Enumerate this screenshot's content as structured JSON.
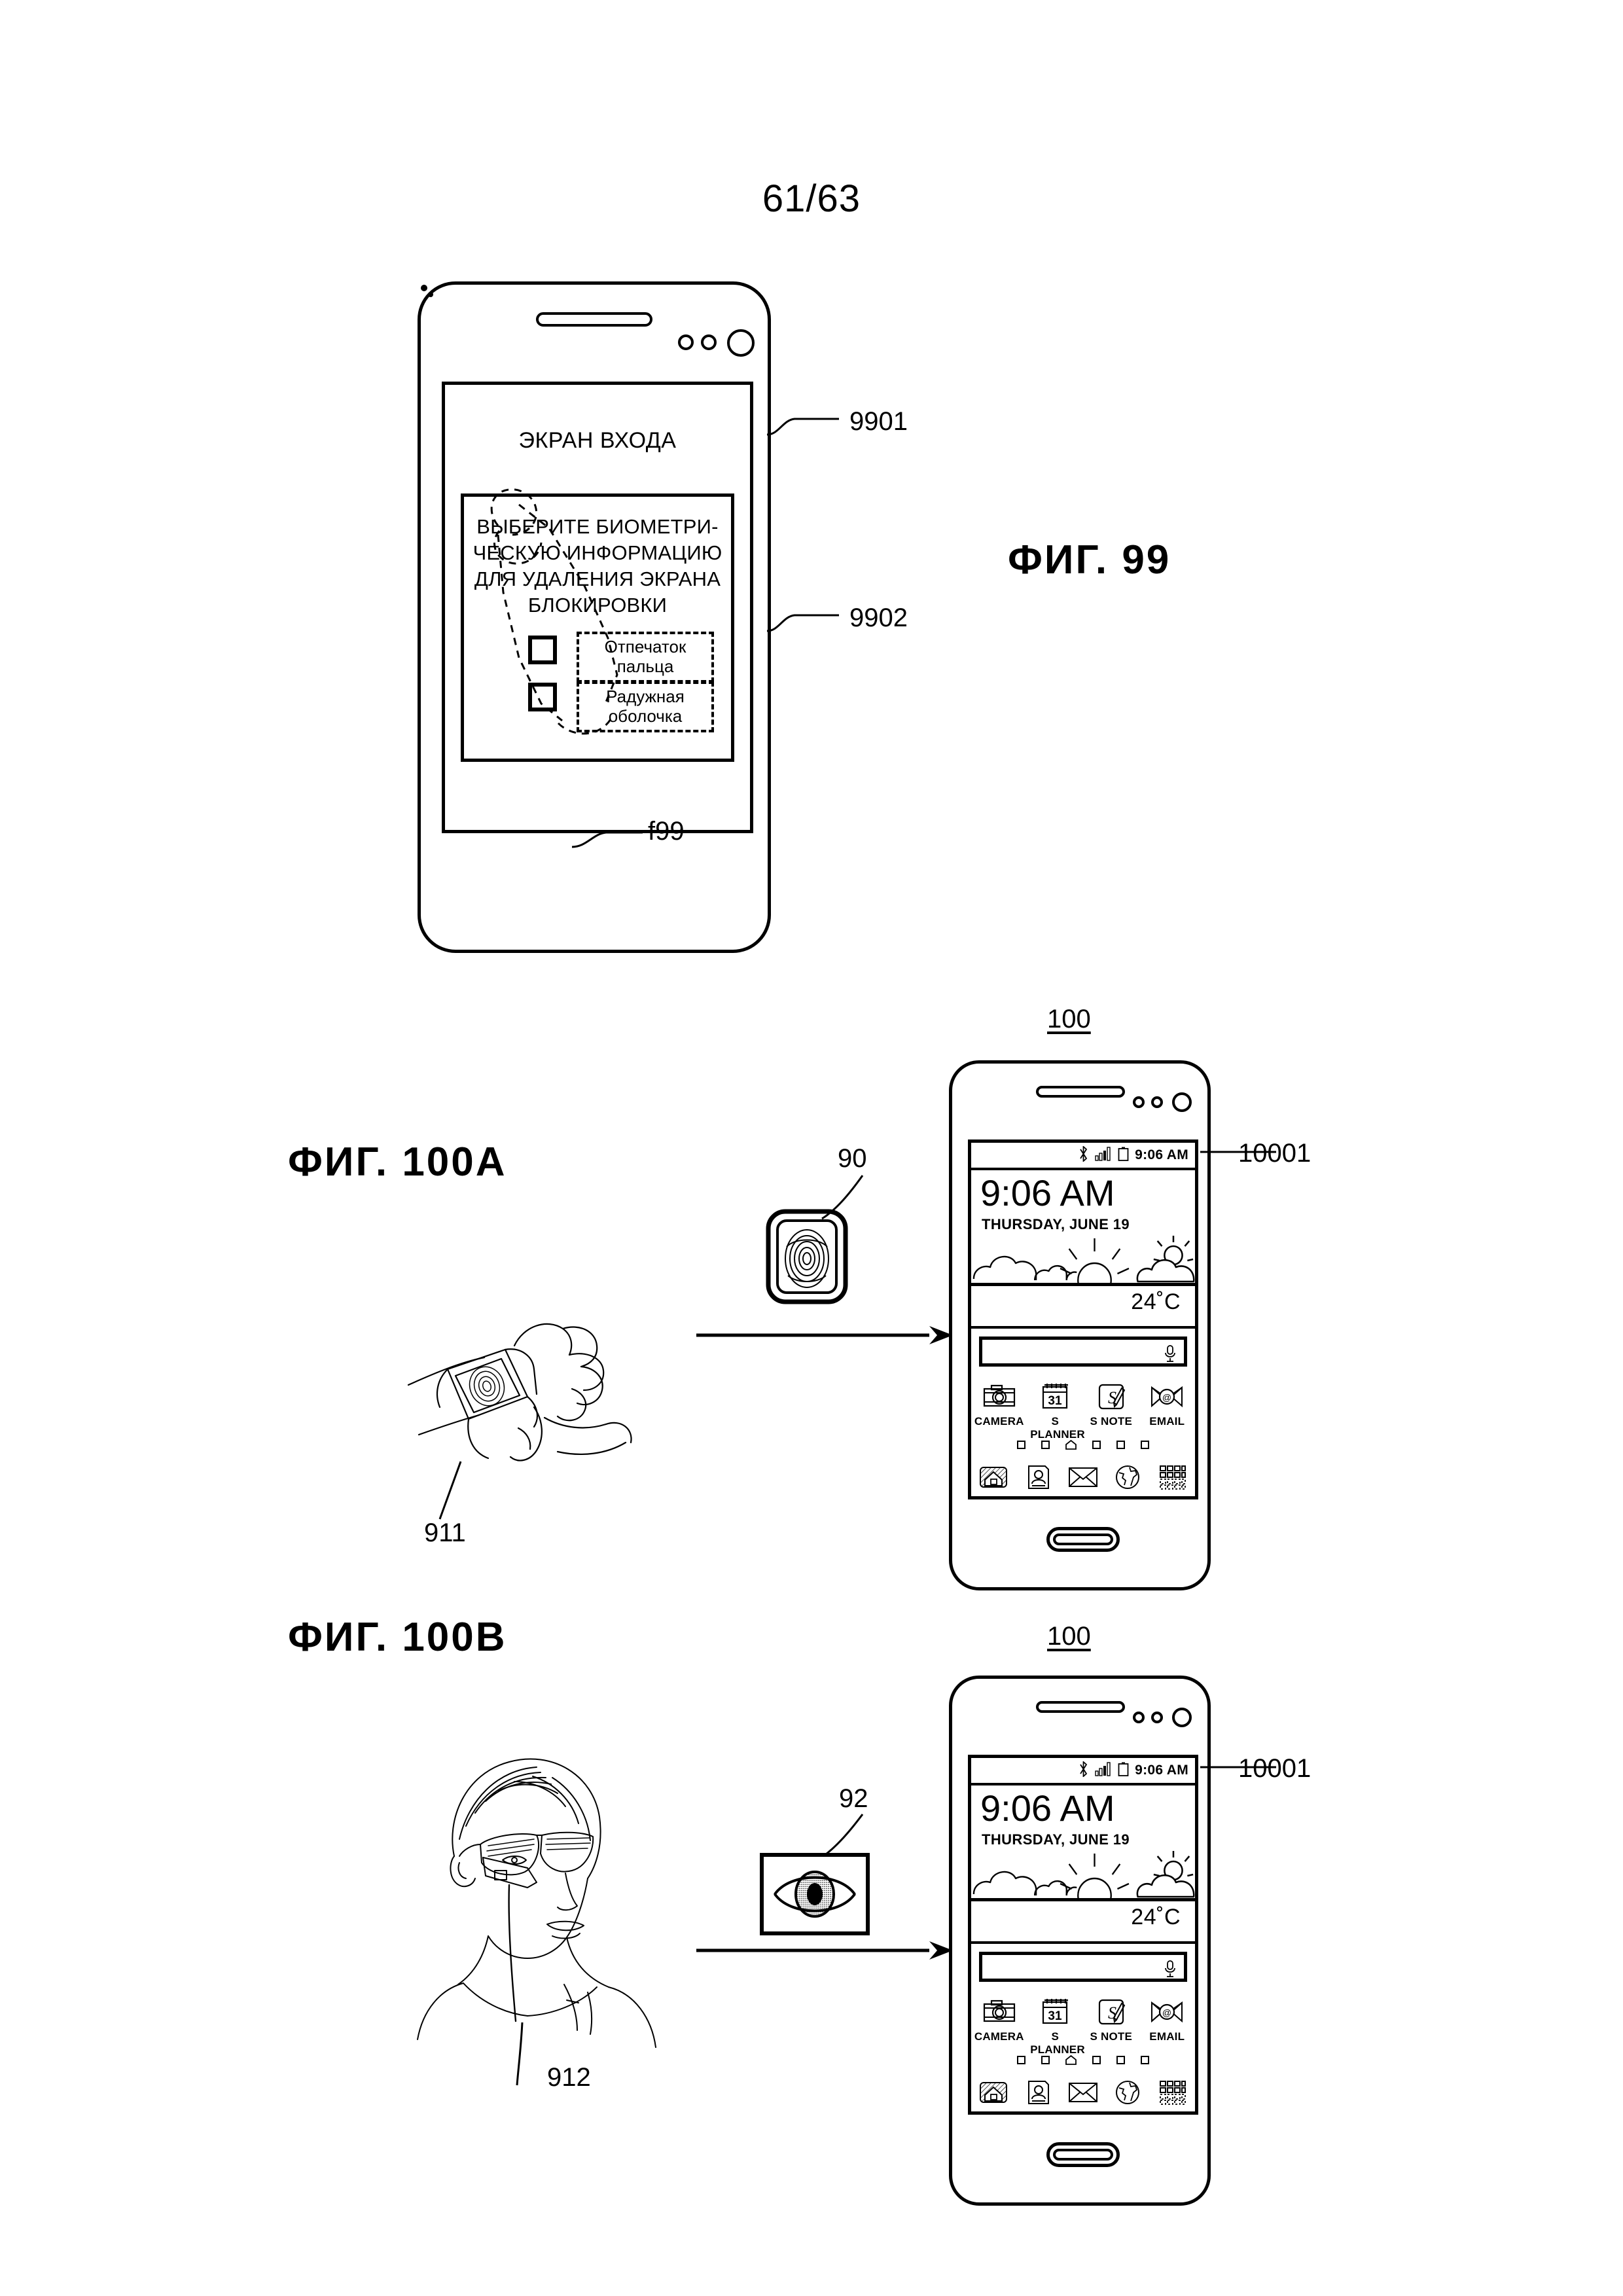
{
  "page": {
    "page_number": "61/63"
  },
  "fig99": {
    "label": "ФИГ. 99",
    "screen_title": "ЭКРАН ВХОДА",
    "message_lines": [
      "ВЫБЕРИТЕ БИОМЕТРИ-",
      "ЧЕСКУЮ ИНФОРМАЦИЮ",
      "ДЛЯ УДАЛЕНИЯ ЭКРАНА",
      "БЛОКИРОВКИ"
    ],
    "options": [
      {
        "id": "fingerprint",
        "line1": "Отпечаток",
        "line2": "пальца",
        "checked": false
      },
      {
        "id": "iris",
        "line1": "Радужная",
        "line2": "оболочка",
        "checked": false
      }
    ],
    "refs": {
      "screen": "9901",
      "message_box": "9902",
      "finger": "f99"
    }
  },
  "fig100a": {
    "label": "ФИГ. 100А",
    "device_ref": "100",
    "screen_ref": "10001",
    "watch_ref": "911",
    "biometric_ref": "90",
    "biometric_icon": "fingerprint-icon"
  },
  "fig100b": {
    "label": "ФИГ. 100В",
    "device_ref": "100",
    "screen_ref": "10001",
    "glasses_ref": "912",
    "biometric_ref": "92",
    "biometric_icon": "iris-icon"
  },
  "home_screen": {
    "statusbar": {
      "bluetooth_icon": "bluetooth-icon",
      "signal_icon": "signal-bars-icon",
      "battery_icon": "battery-icon",
      "clock": "9:06 AM"
    },
    "widget": {
      "time": "9:06 AM",
      "date": "THURSDAY, JUNE 19",
      "temperature": "24˚C",
      "weather_icon": "sun-behind-clouds-icon"
    },
    "search": {
      "value": "",
      "mic_icon": "microphone-icon"
    },
    "apps": [
      {
        "name": "CAMERA",
        "icon": "camera-icon"
      },
      {
        "name": "S PLANNER",
        "icon": "calendar-icon",
        "badge": "31"
      },
      {
        "name": "S NOTE",
        "icon": "s-note-pen-icon"
      },
      {
        "name": "EMAIL",
        "icon": "email-at-icon"
      }
    ],
    "page_dots": 6,
    "active_dot_index": 2,
    "dock": [
      {
        "icon": "home-phone-icon"
      },
      {
        "icon": "contacts-icon"
      },
      {
        "icon": "messages-envelope-icon"
      },
      {
        "icon": "browser-globe-icon"
      },
      {
        "icon": "apps-grid-icon"
      }
    ]
  },
  "colors": {
    "ink": "#000000",
    "paper": "#ffffff"
  }
}
